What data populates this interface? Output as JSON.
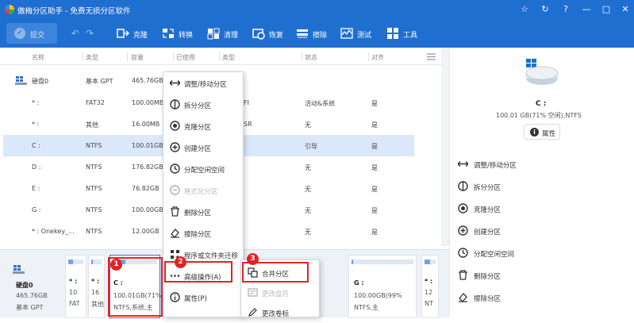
{
  "app": {
    "title": "傲梅分区助手 - 免费无损分区软件",
    "window_controls": [
      "star-icon",
      "refresh-icon",
      "question-icon",
      "minimize-icon",
      "maximize-icon",
      "close-icon"
    ]
  },
  "toolbar": {
    "submit_label": "提交",
    "tools": [
      {
        "icon": "clone-icon",
        "label": "克隆"
      },
      {
        "icon": "convert-icon",
        "label": "转换"
      },
      {
        "icon": "clean-icon",
        "label": "清理"
      },
      {
        "icon": "restore-icon",
        "label": "恢复"
      },
      {
        "icon": "wipe-icon",
        "label": "擦除"
      },
      {
        "icon": "test-icon",
        "label": "测试"
      },
      {
        "icon": "tools-icon",
        "label": "工具"
      }
    ]
  },
  "table": {
    "headers": [
      "名称",
      "类型",
      "容量",
      "已使用",
      "类型",
      "状态",
      "对齐"
    ],
    "disk_row": {
      "name": "硬盘0",
      "type": "基本 GPT",
      "capacity": "465.76GB"
    },
    "rows": [
      {
        "name": "* :",
        "type": "FAT32",
        "capacity": "100.00MB",
        "used": "",
        "ftype": "FI",
        "status": "活动&系统",
        "align": "是"
      },
      {
        "name": "* :",
        "type": "其他",
        "capacity": "16.00MB",
        "used": "",
        "ftype": "SR",
        "status": "无",
        "align": "是"
      },
      {
        "name": "C :",
        "type": "NTFS",
        "capacity": "100.01GB",
        "used": "",
        "ftype": "",
        "status": "引导",
        "align": "是"
      },
      {
        "name": "D :",
        "type": "NTFS",
        "capacity": "176.82GB",
        "used": "",
        "ftype": "",
        "status": "无",
        "align": "是"
      },
      {
        "name": "E :",
        "type": "NTFS",
        "capacity": "76.82GB",
        "used": "",
        "ftype": "",
        "status": "无",
        "align": "是"
      },
      {
        "name": "G :",
        "type": "NTFS",
        "capacity": "100.00GB",
        "used": "",
        "ftype": "",
        "status": "无",
        "align": "是"
      },
      {
        "name": "* : Onekey_...",
        "type": "NTFS",
        "capacity": "12.00GB",
        "used": "",
        "ftype": "",
        "status": "无",
        "align": "是"
      }
    ]
  },
  "disk_map": {
    "disk": {
      "name": "硬盘0",
      "size": "465.76GB",
      "type": "基本 GPT"
    },
    "blocks": [
      {
        "l1": "* :",
        "l2": "10",
        "l3": "FAT",
        "fill": 0.3
      },
      {
        "l1": "* :",
        "l2": "16",
        "l3": "其他",
        "fill": 0.1
      },
      {
        "l1": "C :",
        "l2": "100.01GB(71%",
        "l3": "NTFS,系统,主",
        "fill": 0.71
      },
      {
        "l1": "G :",
        "l2": "100.00GB(99%",
        "l3": "NTFS,主",
        "fill": 0.99
      },
      {
        "l1": "* :",
        "l2": "12",
        "l3": "NT",
        "fill": 0.5
      }
    ]
  },
  "context_menu": {
    "items": [
      {
        "icon": "resize-move-icon",
        "label": "调整/移动分区",
        "disabled": false
      },
      {
        "icon": "split-icon",
        "label": "拆分分区",
        "disabled": false
      },
      {
        "icon": "clone-partition-icon",
        "label": "克隆分区",
        "disabled": false
      },
      {
        "icon": "create-partition-icon",
        "label": "创建分区",
        "disabled": false
      },
      {
        "icon": "allocate-space-icon",
        "label": "分配空闲空间",
        "disabled": false
      },
      {
        "icon": "format-icon",
        "label": "格式化分区",
        "disabled": true
      },
      {
        "icon": "delete-icon",
        "label": "删除分区",
        "disabled": false
      },
      {
        "icon": "eraser-icon",
        "label": "擦除分区",
        "disabled": false
      },
      {
        "icon": "migrate-icon",
        "label": "程序或文件夹迁移",
        "disabled": false
      },
      {
        "icon": "more-icon",
        "label": "高级操作(A)",
        "disabled": false
      },
      {
        "icon": "info-icon",
        "label": "属性(P)",
        "disabled": false
      }
    ]
  },
  "submenu": {
    "items": [
      {
        "icon": "merge-icon",
        "label": "合并分区",
        "disabled": false
      },
      {
        "icon": "change-serial-icon",
        "label": "更改盘符",
        "disabled": true
      },
      {
        "icon": "edit-label-icon",
        "label": "更改卷标",
        "disabled": false
      }
    ]
  },
  "right_panel": {
    "drive": "C :",
    "info": "100.01 GB(71% 空闲),NTFS",
    "property_label": "属性",
    "actions": [
      {
        "icon": "resize-move-icon",
        "label": "调整/移动分区"
      },
      {
        "icon": "split-icon",
        "label": "拆分分区"
      },
      {
        "icon": "clone-partition-icon",
        "label": "克隆分区"
      },
      {
        "icon": "create-partition-icon",
        "label": "创建分区"
      },
      {
        "icon": "allocate-space-icon",
        "label": "分配空闲空间"
      },
      {
        "icon": "delete-icon",
        "label": "删除分区"
      },
      {
        "icon": "eraser-icon",
        "label": "擦除分区"
      }
    ]
  },
  "annotations": {
    "badges": [
      "1",
      "2",
      "3"
    ]
  },
  "colors": {
    "accent": "#1f6fd0",
    "selected_row": "#dbe8f9",
    "highlight": "#e02424"
  }
}
